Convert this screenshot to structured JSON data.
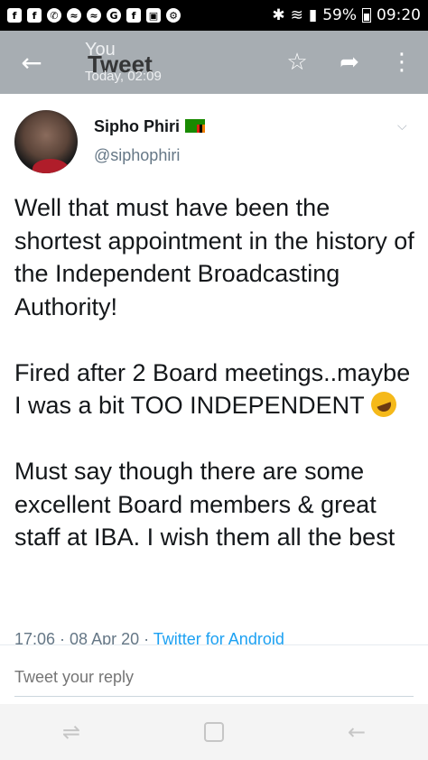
{
  "status_bar": {
    "left_icons": [
      {
        "name": "facebook-icon",
        "glyph": "f"
      },
      {
        "name": "facebook-icon",
        "glyph": "f"
      },
      {
        "name": "whatsapp-icon",
        "glyph": "✆"
      },
      {
        "name": "messenger-icon",
        "glyph": "≈"
      },
      {
        "name": "messenger-icon",
        "glyph": "≈"
      },
      {
        "name": "google-icon",
        "glyph": "G"
      },
      {
        "name": "facebook-icon",
        "glyph": "f"
      },
      {
        "name": "gallery-icon",
        "glyph": "▣"
      },
      {
        "name": "settings-icon",
        "glyph": "⚙"
      }
    ],
    "battery": "59%",
    "time": "09:20"
  },
  "app_bar": {
    "back_icon": "←",
    "subtitle_top": "You",
    "title": "Tweet",
    "subtitle_time": "Today, 02:09",
    "star_icon": "☆",
    "share_icon": "➦",
    "menu_icon": "⋮"
  },
  "tweet": {
    "author_name": "Sipho Phiri",
    "author_handle": "@siphophiri",
    "paragraph_1": "Well that must have been the shortest appointment in the history of the Independent Broadcasting Authority!",
    "paragraph_2": "Fired after 2 Board meetings..maybe I was a bit TOO INDEPENDENT",
    "paragraph_3": "Must say though there are some excellent Board members & great staff at IBA. I wish them all the best",
    "time": "17:06",
    "date": "08 Apr 20",
    "source": "Twitter for Android",
    "separator": " · "
  },
  "reply": {
    "placeholder": "Tweet your reply"
  },
  "nav_bar": {
    "recents_icon": "⇌",
    "back_icon": "←"
  },
  "colors": {
    "app_bar_bg": "#a7adb2",
    "link": "#1da1f2",
    "secondary_text": "#657786"
  }
}
